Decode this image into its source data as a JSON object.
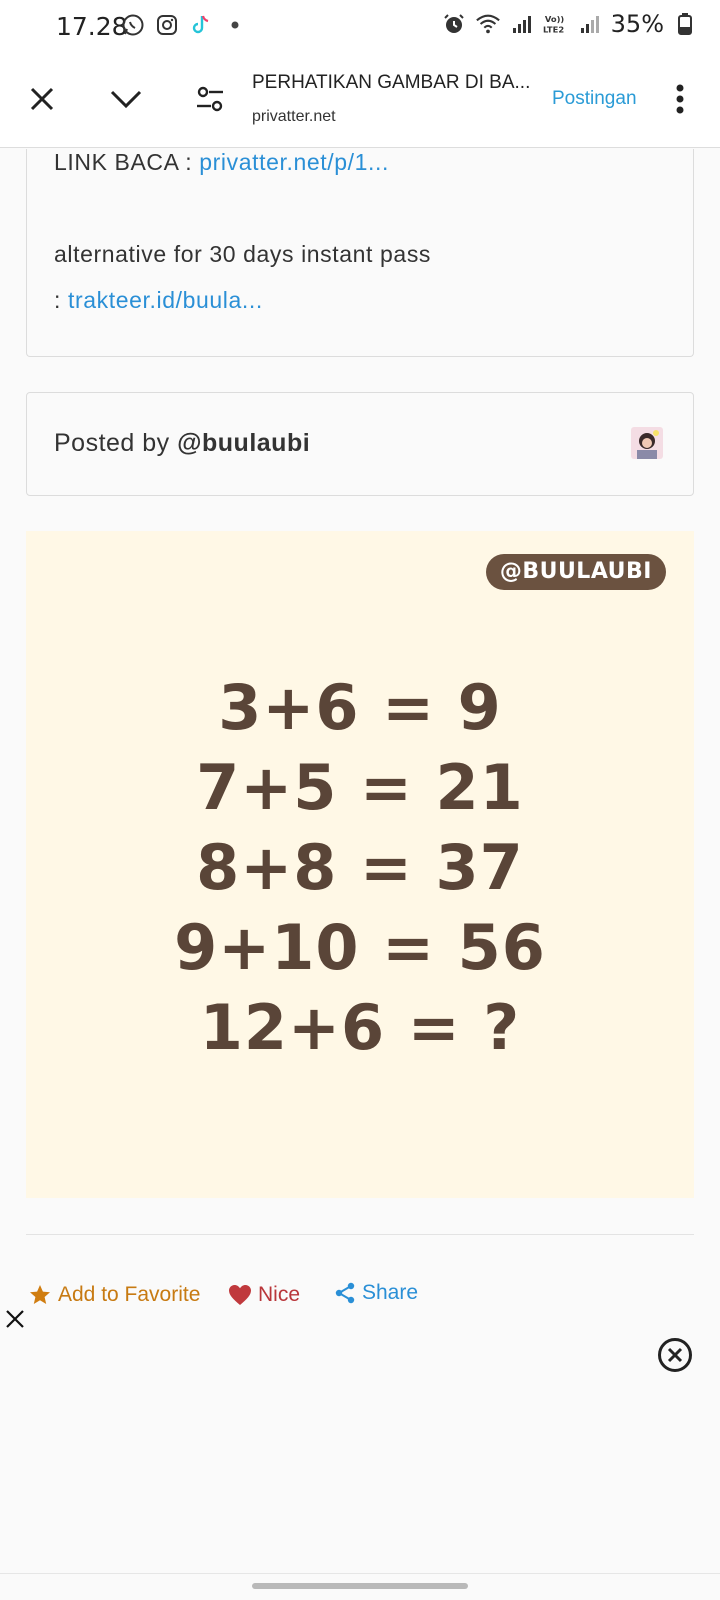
{
  "status": {
    "time": "17.28",
    "battery": "35%"
  },
  "browser": {
    "title": "PERHATIKAN GAMBAR DI BA...",
    "domain": "privatter.net",
    "action_link": "Postingan"
  },
  "post": {
    "read_link_label": "LINK BACA : ",
    "read_link_url": "privatter.net/p/1...",
    "alternative_text": "alternative for 30 days instant pass",
    "alternative_prefix": ": ",
    "alternative_link": "trakteer.id/buula...",
    "posted_by_label": "Posted by ",
    "posted_by_user": "@buulaubi"
  },
  "image": {
    "watermark": "@BUULAUBI",
    "equations": [
      "3+6 = 9",
      "7+5 = 21",
      "8+8 = 37",
      "9+10 = 56",
      "12+6 = ?"
    ]
  },
  "actions": {
    "favorite": "Add to Favorite",
    "nice": "Nice",
    "share": "Share"
  },
  "colors": {
    "link": "#2a8fd6",
    "favorite": "#c77a12",
    "nice": "#b9363a",
    "image_bg": "#fff8e6",
    "equation_text": "#5a4538"
  }
}
